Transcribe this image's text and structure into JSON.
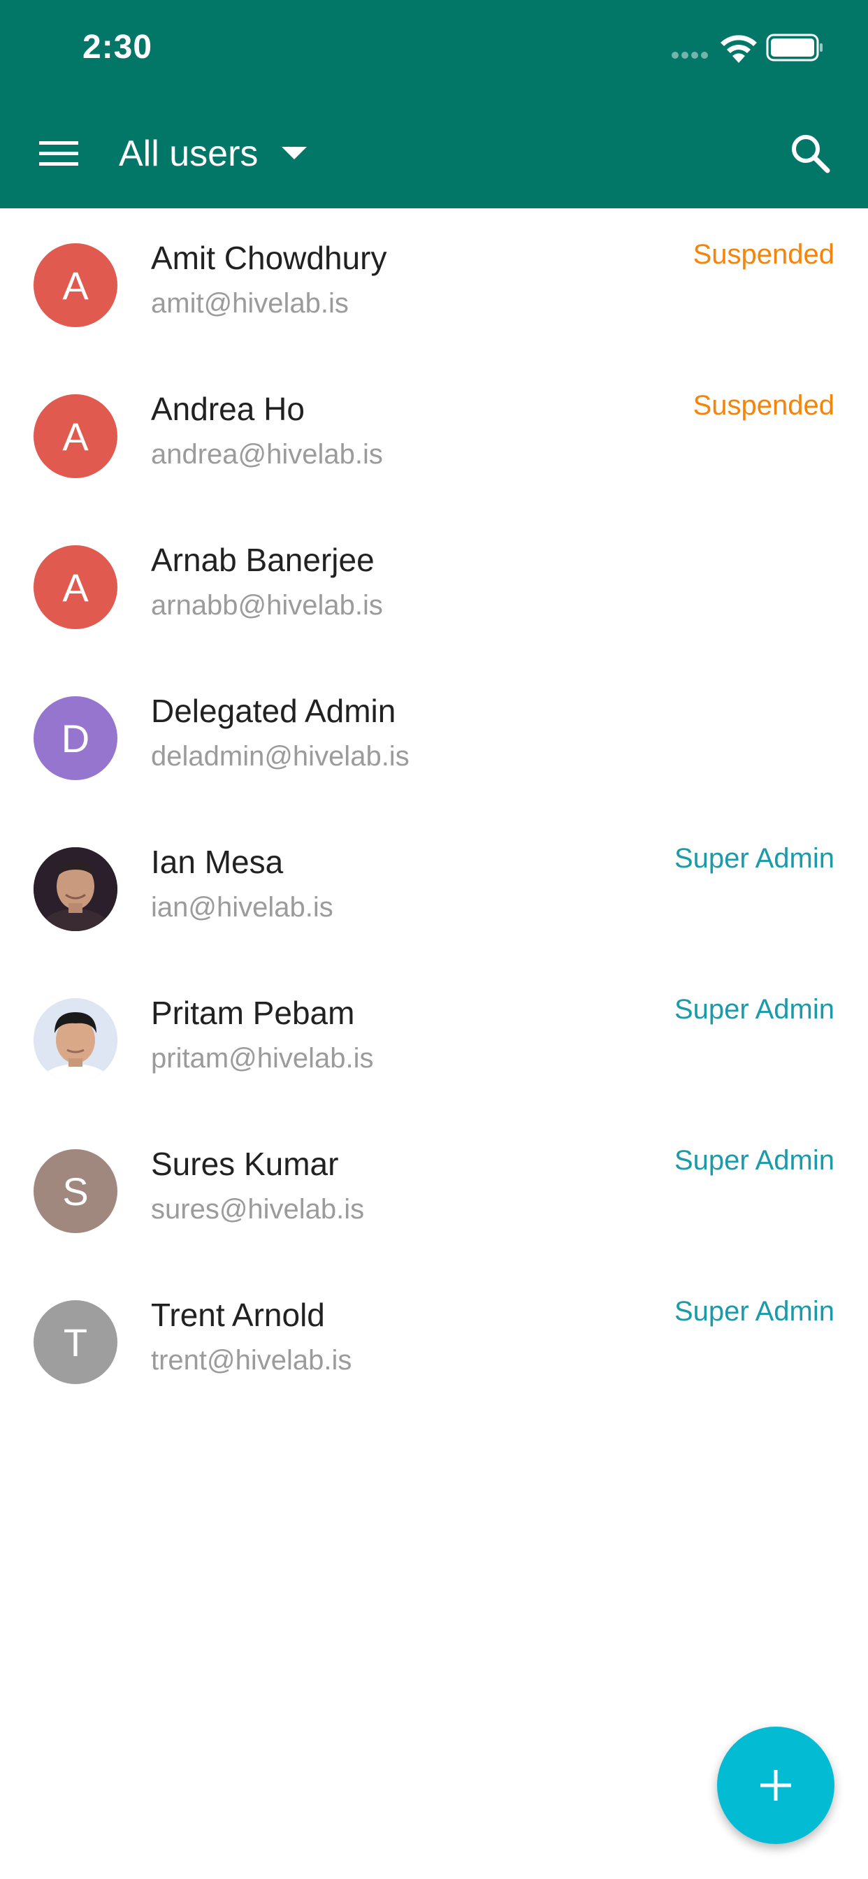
{
  "status_bar": {
    "time": "2:30"
  },
  "toolbar": {
    "title": "All users"
  },
  "colors": {
    "app_bar": "#027768",
    "suspended": "#F5840A",
    "super_admin": "#1B9AAA",
    "fab": "#03BCD4"
  },
  "users": [
    {
      "name": "Amit Chowdhury",
      "email": "amit@hivelab.is",
      "role": "Suspended",
      "initial": "A",
      "avatar_color": "#E05A4F"
    },
    {
      "name": "Andrea Ho",
      "email": "andrea@hivelab.is",
      "role": "Suspended",
      "initial": "A",
      "avatar_color": "#E05A4F"
    },
    {
      "name": "Arnab Banerjee",
      "email": "arnabb@hivelab.is",
      "role": "",
      "initial": "A",
      "avatar_color": "#E05A4F"
    },
    {
      "name": "Delegated Admin",
      "email": "deladmin@hivelab.is",
      "role": "",
      "initial": "D",
      "avatar_color": "#9575CD"
    },
    {
      "name": "Ian Mesa",
      "email": "ian@hivelab.is",
      "role": "Super Admin",
      "initial": "",
      "avatar_color": "#2A1F2A"
    },
    {
      "name": "Pritam Pebam",
      "email": "pritam@hivelab.is",
      "role": "Super Admin",
      "initial": "",
      "avatar_color": "#D7E3F2"
    },
    {
      "name": "Sures Kumar",
      "email": "sures@hivelab.is",
      "role": "Super Admin",
      "initial": "S",
      "avatar_color": "#A1887F"
    },
    {
      "name": "Trent Arnold",
      "email": "trent@hivelab.is",
      "role": "Super Admin",
      "initial": "T",
      "avatar_color": "#9E9E9E"
    }
  ],
  "icons": {
    "menu": "menu-icon",
    "dropdown": "arrow-drop-down-icon",
    "search": "search-icon",
    "add": "add-icon"
  }
}
